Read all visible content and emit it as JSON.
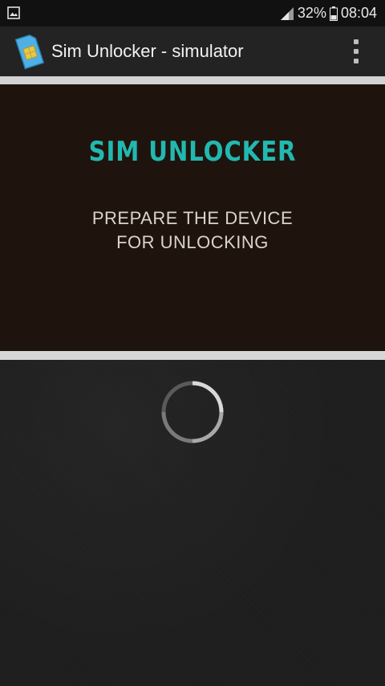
{
  "status_bar": {
    "battery_percent": "32%",
    "time": "08:04",
    "left_icon": "image-icon",
    "signal_icon": "signal-icon",
    "battery_icon": "battery-icon"
  },
  "app_bar": {
    "title": "Sim Unlocker - simulator",
    "app_icon": "sim-card-icon",
    "menu_icon": "overflow-menu-icon"
  },
  "panel": {
    "brand": "SIM UNLOCKER",
    "message_line1": "PREPARE THE DEVICE",
    "message_line2": "FOR UNLOCKING"
  },
  "loader": {
    "icon": "loading-spinner-icon"
  },
  "colors": {
    "accent": "#22b8b0",
    "panel_bg": "#1f140d",
    "strip": "#d2d2d2"
  }
}
